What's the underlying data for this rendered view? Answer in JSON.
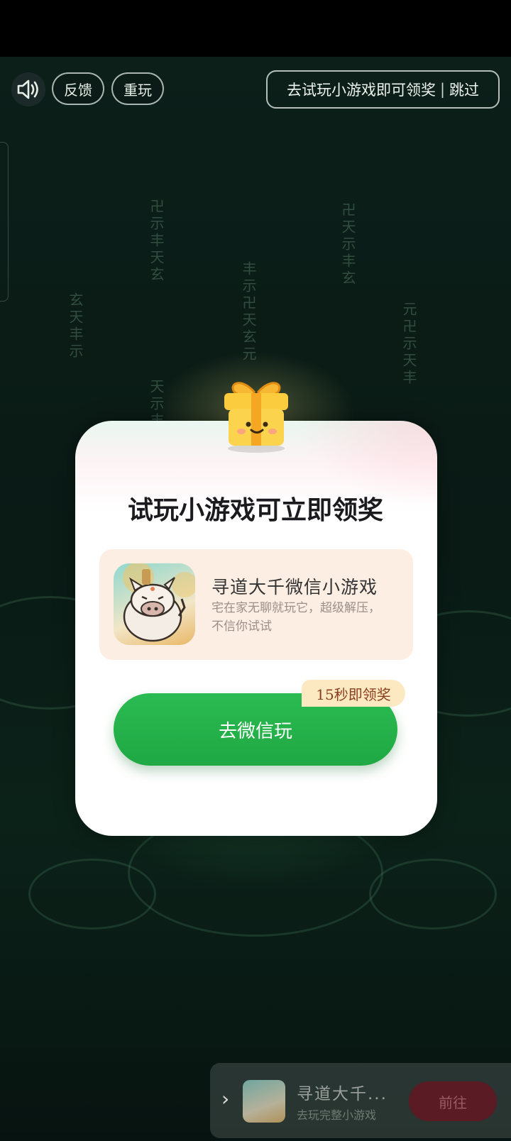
{
  "toolbar": {
    "sound_icon": "speaker-icon",
    "feedback_label": "反馈",
    "replay_label": "重玩",
    "skip_hint": "去试玩小游戏即可领奖",
    "skip_separator": "|",
    "skip_label": "跳过"
  },
  "dialog": {
    "gift_icon": "gift-icon",
    "title": "试玩小游戏可立即领奖",
    "game": {
      "name": "寻道大千微信小游戏",
      "description": "宅在家无聊就玩它，超级解压，不信你试试"
    },
    "play_button": "去微信玩",
    "reward_badge": "15秒即领奖"
  },
  "banner": {
    "arrow": "›",
    "title": "寻道大千...",
    "subtitle": "去玩完整小游戏",
    "action": "前往"
  },
  "colors": {
    "accent_green": "#22b14c",
    "badge_bg": "#fde9c1",
    "banner_button": "#5a1b25"
  }
}
